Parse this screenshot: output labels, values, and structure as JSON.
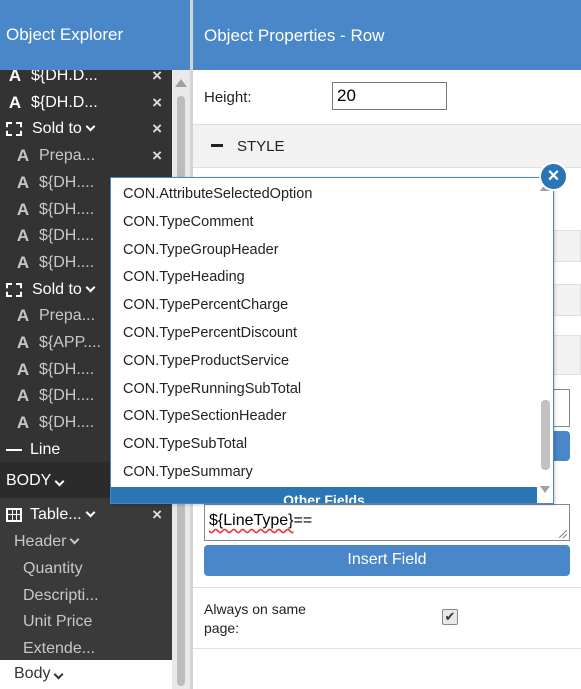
{
  "left_panel": {
    "title": "Object Explorer",
    "tree": [
      {
        "icon": "A",
        "label": "${DH.D...",
        "dim": false,
        "closable": true
      },
      {
        "icon": "A",
        "label": "${DH.D...",
        "dim": false,
        "closable": true
      },
      {
        "icon": "dashed",
        "label": "Sold to",
        "dim": false,
        "closable": true,
        "chevron": true
      },
      {
        "icon": "A",
        "label": "Prepa...",
        "dim": true,
        "closable": true
      },
      {
        "icon": "A",
        "label": "${DH....",
        "dim": true,
        "closable": false
      },
      {
        "icon": "A",
        "label": "${DH....",
        "dim": true,
        "closable": false
      },
      {
        "icon": "A",
        "label": "${DH....",
        "dim": true,
        "closable": false
      },
      {
        "icon": "A",
        "label": "${DH....",
        "dim": true,
        "closable": false
      },
      {
        "icon": "dashed",
        "label": "Sold to",
        "dim": false,
        "closable": false,
        "chevron": true
      },
      {
        "icon": "A",
        "label": "Prepa...",
        "dim": true,
        "closable": false
      },
      {
        "icon": "A",
        "label": "${APP....",
        "dim": true,
        "closable": false
      },
      {
        "icon": "A",
        "label": "${DH....",
        "dim": true,
        "closable": false
      },
      {
        "icon": "A",
        "label": "${DH....",
        "dim": true,
        "closable": false
      },
      {
        "icon": "A",
        "label": "${DH....",
        "dim": true,
        "closable": false
      },
      {
        "icon": "line",
        "label": "Line",
        "dim": false,
        "closable": false
      }
    ],
    "body_section": "BODY",
    "table_label": "Table...",
    "header_label": "Header",
    "header_items": [
      "Quantity",
      "Descripti...",
      "Unit Price",
      "Extende..."
    ],
    "bottom_label": "Body"
  },
  "right_panel": {
    "title": "Object Properties - Row",
    "height_label": "Height:",
    "height_value": "20",
    "style_section": "STYLE",
    "expression_prefix": "${LineType}",
    "expression_suffix": "==",
    "insert_button": "Insert Field",
    "always_label": "Always on same page:",
    "always_checked": "✔"
  },
  "dropdown": {
    "options": [
      "CON.AttributeSelectedOption",
      "CON.TypeComment",
      "CON.TypeGroupHeader",
      "CON.TypeHeading",
      "CON.TypePercentCharge",
      "CON.TypePercentDiscount",
      "CON.TypeProductService",
      "CON.TypeRunningSubTotal",
      "CON.TypeSectionHeader",
      "CON.TypeSubTotal",
      "CON.TypeSummary"
    ],
    "group_label": "Other Fields",
    "close_glyph": "×"
  },
  "icons": {
    "close": "×",
    "text_icon": "A"
  },
  "colors": {
    "header_blue": "#4a87c9",
    "dark_panel": "#333333",
    "group_blue": "#2a75b3"
  }
}
